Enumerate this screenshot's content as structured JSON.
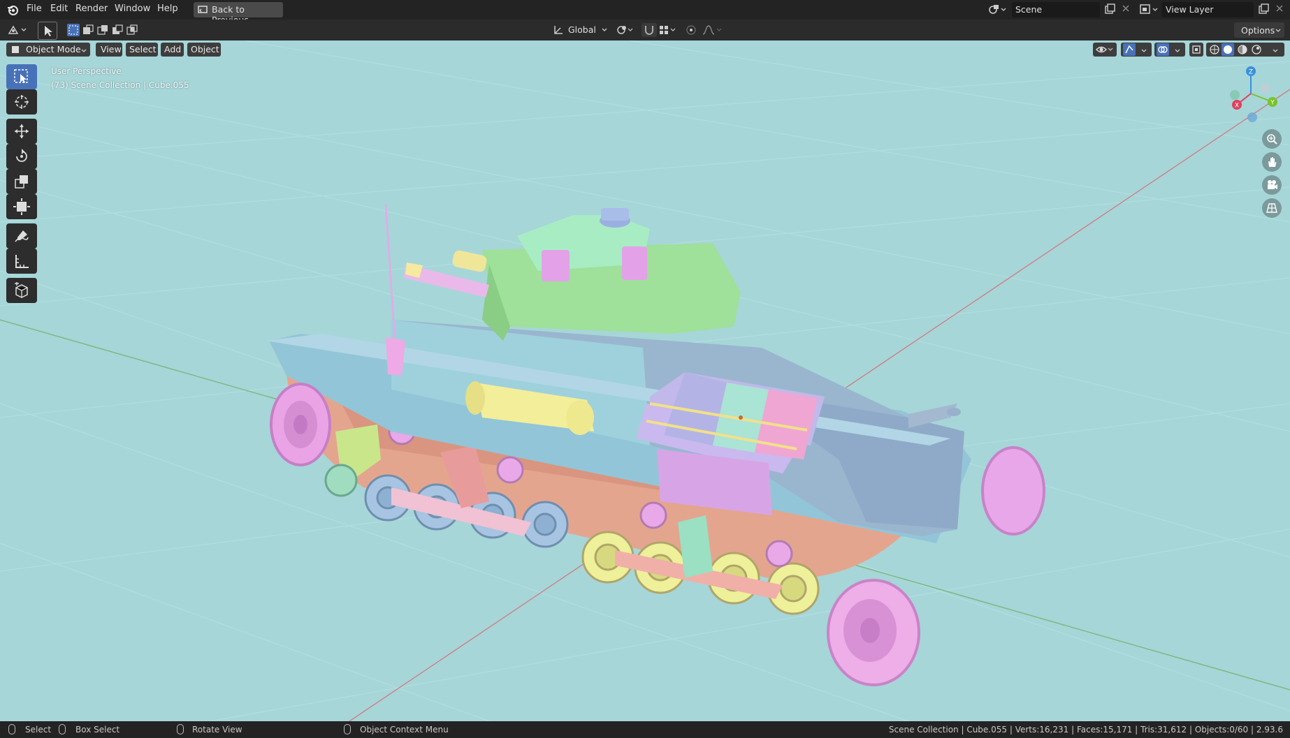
{
  "app": {
    "menu": [
      "File",
      "Edit",
      "Render",
      "Window",
      "Help"
    ],
    "back_button": "Back to Previous",
    "scene_label": "Scene",
    "view_layer_label": "View Layer"
  },
  "toolbar": {
    "transform_orientation": "Global",
    "options_label": "Options"
  },
  "viewport_header": {
    "mode": "Object Mode",
    "menus": [
      "View",
      "Select",
      "Add",
      "Object"
    ]
  },
  "viewport_overlay": {
    "perspective": "User Perspective",
    "collection": "(73) Scene Collection | Cube.055"
  },
  "gizmo": {
    "z": "Z",
    "y": "Y",
    "x": "X"
  },
  "tools": [
    "select-box-icon",
    "cursor-icon",
    "move-icon",
    "rotate-icon",
    "scale-icon",
    "transform-icon",
    "annotate-icon",
    "measure-icon",
    "add-cube-icon"
  ],
  "nav_icons": [
    "zoom-icon",
    "pan-hand-icon",
    "camera-icon",
    "ortho-grid-icon"
  ],
  "statusbar": {
    "select": "Select",
    "box_select": "Box Select",
    "rotate_view": "Rotate View",
    "context_menu": "Object Context Menu",
    "stats": "Scene Collection | Cube.055 | Verts:16,231 | Faces:15,171 | Tris:31,612 | Objects:0/60 | 2.93.6"
  },
  "colors": {
    "viewport_bg": "#a6d6d8",
    "active_tool": "#4872b8",
    "axis_x": "#e0405a",
    "axis_y": "#7ac22c",
    "axis_z": "#3a8fe0"
  }
}
